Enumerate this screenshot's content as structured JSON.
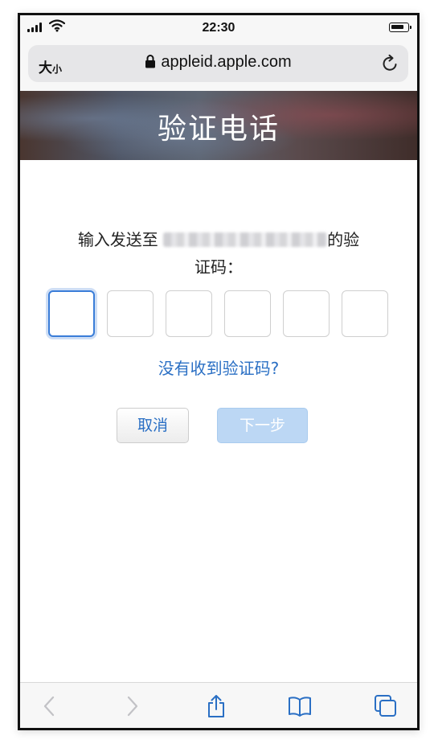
{
  "status_bar": {
    "time": "22:30",
    "icons": [
      "signal-icon",
      "wifi-icon",
      "battery-icon"
    ]
  },
  "address_bar": {
    "text_size_large": "大",
    "text_size_small": "小",
    "url": "appleid.apple.com",
    "icons": [
      "lock-icon",
      "reload-icon"
    ]
  },
  "hero": {
    "title": "验证电话"
  },
  "prompt": {
    "line_before": "输入发送至",
    "line_after": "的验",
    "line_2": "证码："
  },
  "code_inputs": {
    "count": 6,
    "active_index": 0,
    "values": [
      "",
      "",
      "",
      "",
      "",
      ""
    ]
  },
  "resend_link": "没有收到验证码?",
  "buttons": {
    "cancel": "取消",
    "next": "下一步"
  },
  "toolbar": {
    "icons": [
      "back-icon",
      "forward-icon",
      "share-icon",
      "bookmarks-icon",
      "tabs-icon"
    ]
  },
  "colors": {
    "link": "#2a6fc4",
    "active_border": "#3a7dd8",
    "next_disabled_bg": "#bcd7f4"
  }
}
